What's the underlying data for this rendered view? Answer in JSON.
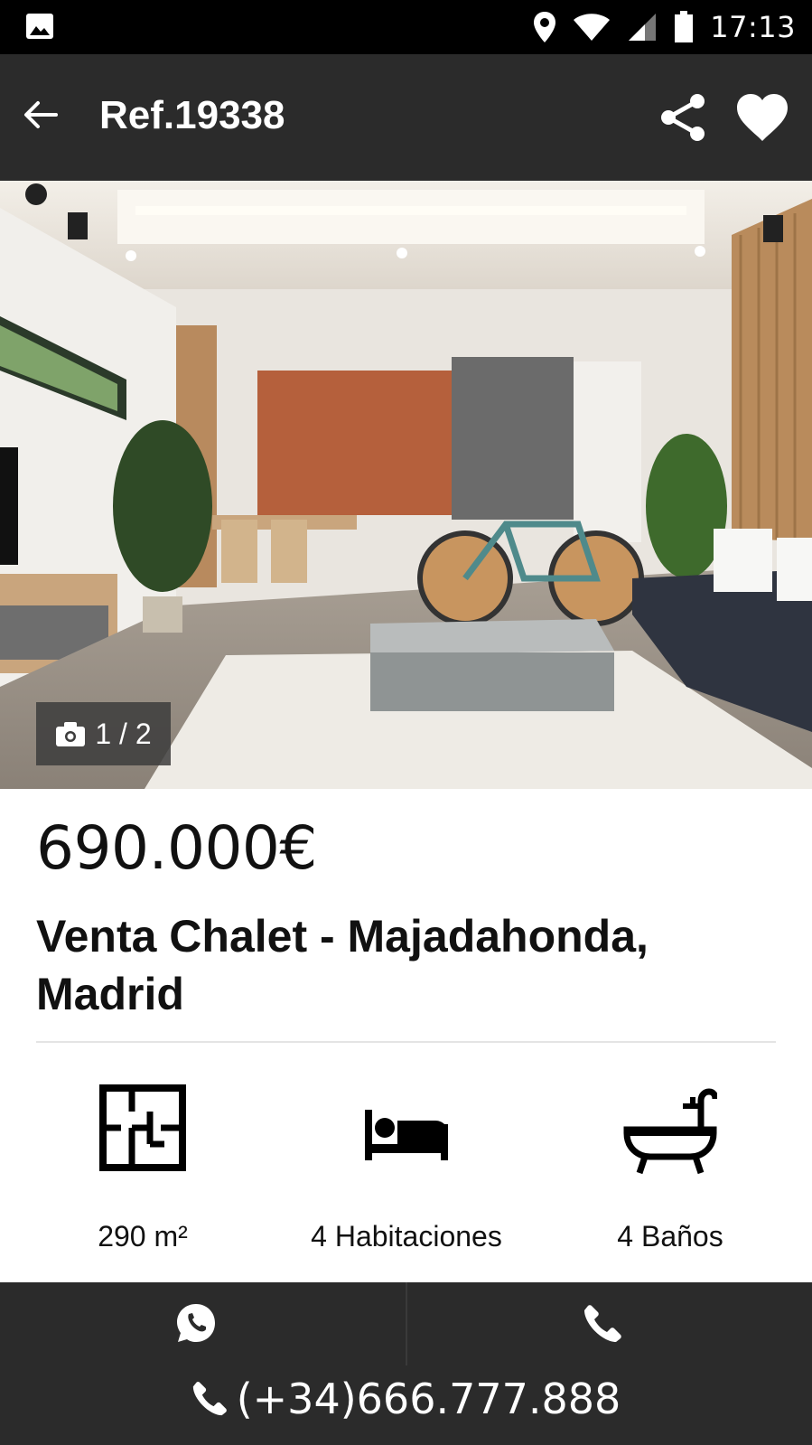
{
  "status_bar": {
    "time": "17:13",
    "icons": [
      "image-icon",
      "location-icon",
      "wifi-icon",
      "signal-icon",
      "battery-icon"
    ]
  },
  "app_bar": {
    "title": "Ref.19338",
    "icons": [
      "back-arrow-icon",
      "share-icon",
      "heart-icon"
    ]
  },
  "gallery": {
    "counter": "1 / 2",
    "icon": "camera-icon"
  },
  "listing": {
    "price": "690.000€",
    "headline": "Venta Chalet - Majadahonda, Madrid"
  },
  "features": [
    {
      "icon": "floor-plan-icon",
      "label": "290 m²"
    },
    {
      "icon": "bed-icon",
      "label": "4 Habitaciones"
    },
    {
      "icon": "bathtub-icon",
      "label": "4 Baños"
    }
  ],
  "contact": {
    "whatsapp_icon": "whatsapp-icon",
    "call_icon": "phone-icon",
    "phone": "(+34)666.777.888"
  },
  "colors": {
    "status_bar": "#000000",
    "app_bar": "#2b2b2b",
    "contact_bar": "#2b2b2b",
    "text": "#111111"
  }
}
